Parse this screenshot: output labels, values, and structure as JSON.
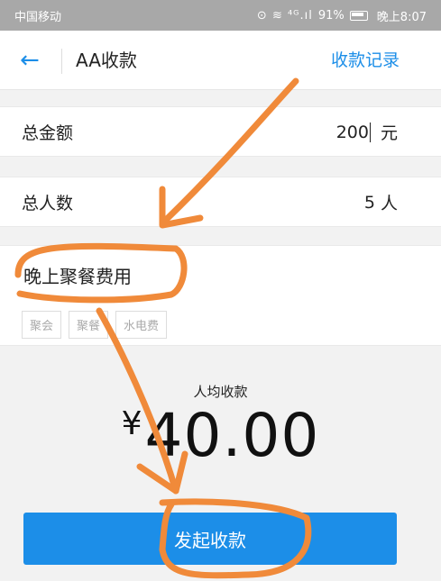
{
  "status_bar": {
    "carrier": "中国移动",
    "icons": "⊙ ≋ ⁴ᴳ.ıl",
    "battery_percent": "91%",
    "time": "晚上8:07"
  },
  "header": {
    "back_icon": "←",
    "title": "AA收款",
    "record_link": "收款记录"
  },
  "form": {
    "total_amount": {
      "label": "总金额",
      "value": "200",
      "unit": "元"
    },
    "total_people": {
      "label": "总人数",
      "value": "5",
      "unit": "人"
    },
    "note": {
      "text": "晚上聚餐费用"
    },
    "tags": [
      "聚会",
      "聚餐",
      "水电费"
    ]
  },
  "summary": {
    "label": "人均收款",
    "currency": "¥",
    "amount": "40.00"
  },
  "actions": {
    "submit_label": "发起收款"
  },
  "colors": {
    "accent": "#1c8ee8",
    "annotation": "#f08a3a"
  }
}
